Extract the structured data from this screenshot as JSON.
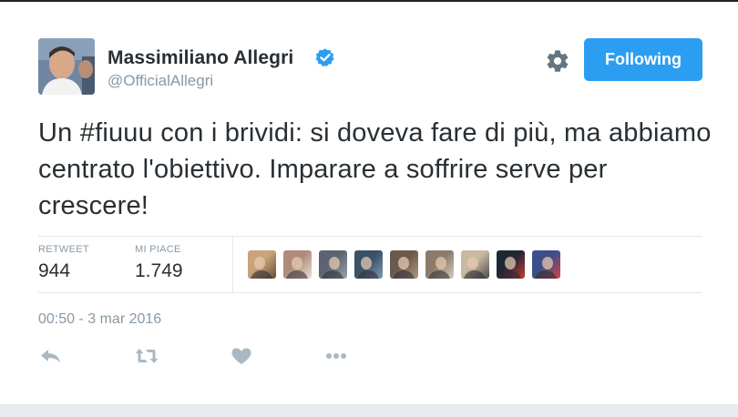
{
  "tweet": {
    "author": {
      "display_name": "Massimiliano Allegri",
      "handle": "@OfficialAllegri",
      "verified": true
    },
    "follow_button_label": "Following",
    "text_prefix": "Un ",
    "hashtag": "#fiuuu",
    "text_suffix": " con i brividi: si doveva fare di più, ma abbiamo centrato l'obiettivo. Imparare a soffrire serve per crescere!",
    "stats": {
      "retweets_label": "RETWEET",
      "retweets_value": "944",
      "likes_label": "MI PIACE",
      "likes_value": "1.749"
    },
    "timestamp": "00:50 - 3 mar 2016",
    "actions": [
      "reply-icon",
      "retweet-icon",
      "heart-icon",
      "more-icon"
    ]
  },
  "colors": {
    "accent": "#2b9ef2",
    "text": "#292f33",
    "muted": "#8899a6",
    "divider": "#e1e8ed"
  },
  "likers": [
    {
      "colors": [
        "#c9a37a",
        "#6b4e34"
      ]
    },
    {
      "colors": [
        "#b08a7a",
        "#e8e2dc"
      ]
    },
    {
      "colors": [
        "#5b6470",
        "#9aa3ad"
      ]
    },
    {
      "colors": [
        "#3a5166",
        "#7d9bb4"
      ]
    },
    {
      "colors": [
        "#6a5a4c",
        "#b39a82"
      ]
    },
    {
      "colors": [
        "#8c7a6a",
        "#d7ccc0"
      ]
    },
    {
      "colors": [
        "#c9b8a2",
        "#4e4a47"
      ]
    },
    {
      "colors": [
        "#1f2733",
        "#c23a3a"
      ]
    },
    {
      "colors": [
        "#3b4f8a",
        "#d4463e"
      ]
    }
  ]
}
